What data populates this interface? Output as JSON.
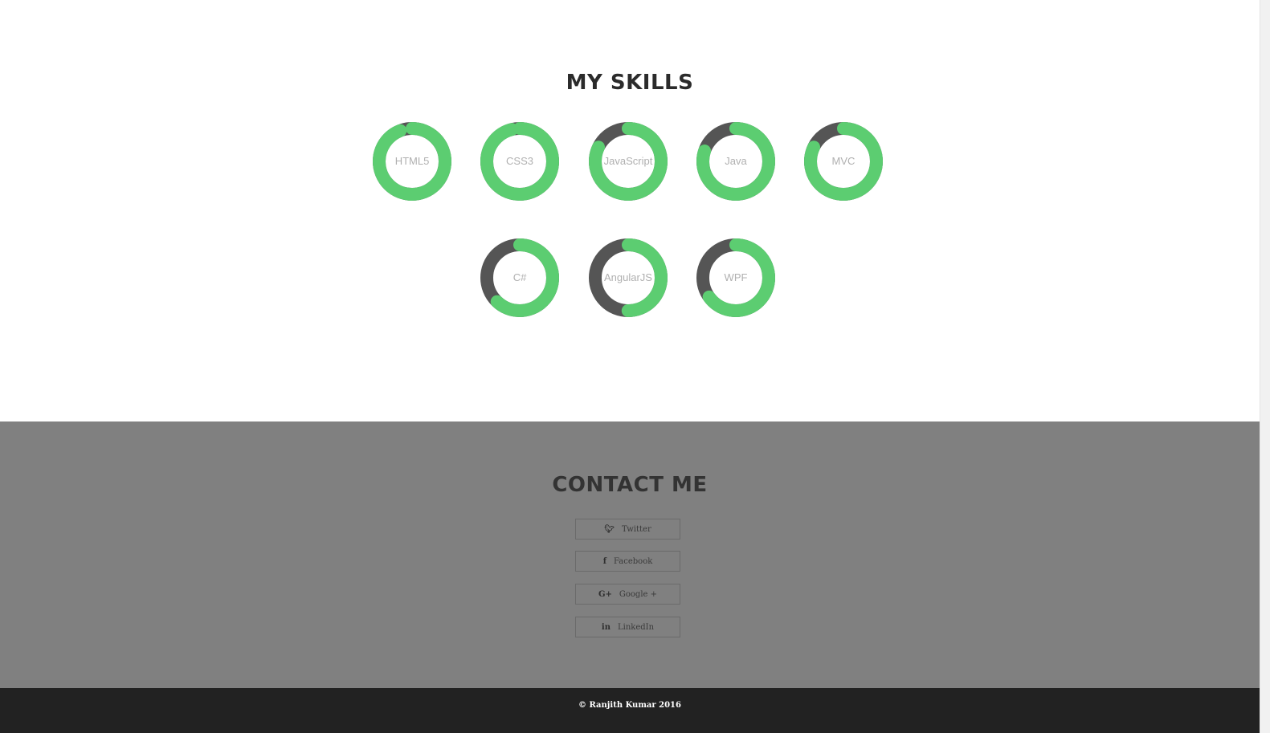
{
  "skills_section": {
    "title": "MY SKILLS",
    "colors": {
      "track": "#555555",
      "fill": "#5ccd71",
      "label": "#b0b0b0"
    },
    "items": [
      {
        "label": "HTML5",
        "level": 0.94
      },
      {
        "label": "CSS3",
        "level": 0.96
      },
      {
        "label": "JavaScript",
        "level": 0.82
      },
      {
        "label": "Java",
        "level": 0.8
      },
      {
        "label": "MVC",
        "level": 0.82
      },
      {
        "label": "C#",
        "level": 0.62
      },
      {
        "label": "AngularJS",
        "level": 0.5
      },
      {
        "label": "WPF",
        "level": 0.65
      }
    ]
  },
  "contact_section": {
    "title": "CONTACT ME",
    "links": [
      {
        "label": "Twitter",
        "icon": "twitter-icon"
      },
      {
        "label": "Facebook",
        "icon": "facebook-icon"
      },
      {
        "label": "Google +",
        "icon": "google-plus-icon"
      },
      {
        "label": "LinkedIn",
        "icon": "linkedin-icon"
      }
    ]
  },
  "footer": {
    "copyright": "© Ranjith Kumar 2016"
  }
}
